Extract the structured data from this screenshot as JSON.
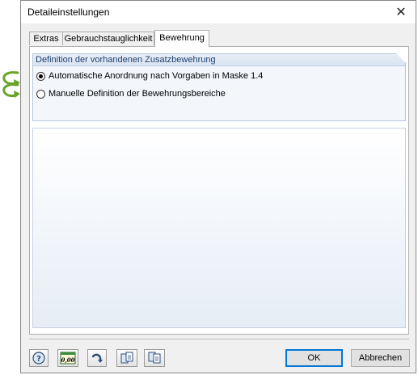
{
  "window": {
    "title": "Detaileinstellungen"
  },
  "tabs": [
    {
      "label": "Extras",
      "active": false
    },
    {
      "label": "Gebrauchstauglichkeit",
      "active": false
    },
    {
      "label": "Bewehrung",
      "active": true
    }
  ],
  "group": {
    "header": "Definition der vorhandenen Zusatzbewehrung",
    "options": [
      {
        "label": "Automatische Anordnung nach Vorgaben in Maske 1.4",
        "checked": true
      },
      {
        "label": "Manuelle Definition der Bewehrungsbereiche",
        "checked": false
      }
    ]
  },
  "toolbar": {
    "calc_icon_text": "0,00"
  },
  "buttons": {
    "ok": "OK",
    "cancel": "Abbrechen"
  },
  "colors": {
    "arrow": "#6aa329",
    "group_header_text": "#1f3f6e",
    "default_button_border": "#0078d7"
  }
}
